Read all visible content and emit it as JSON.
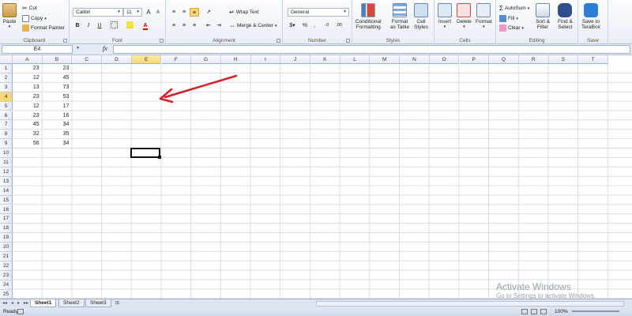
{
  "ribbon": {
    "clipboard": {
      "paste": "Paste",
      "cut": "Cut",
      "copy": "Copy",
      "format_painter": "Format Painter",
      "label": "Clipboard"
    },
    "font": {
      "name": "Calibri",
      "size": "11",
      "label": "Font",
      "bold": "B",
      "italic": "I",
      "underline": "U",
      "grow": "A",
      "shrink": "A"
    },
    "alignment": {
      "wrap_text": "Wrap Text",
      "merge_center": "Merge & Center",
      "label": "Alignment"
    },
    "number": {
      "format": "General",
      "label": "Number",
      "percent": "%",
      "comma": ",",
      "inc_dec": ".0",
      "dec_dec": ".00"
    },
    "styles": {
      "conditional": "Conditional",
      "conditional2": "Formatting",
      "format_table": "Format",
      "format_table2": "as Table",
      "cell_styles": "Cell",
      "cell_styles2": "Styles",
      "label": "Styles"
    },
    "cells": {
      "insert": "Insert",
      "delete": "Delete",
      "format": "Format",
      "label": "Cells"
    },
    "editing": {
      "autosum": "AutoSum",
      "fill": "Fill",
      "clear": "Clear",
      "sort_filter": "Sort &",
      "sort_filter2": "Filter",
      "find_select": "Find &",
      "find_select2": "Select",
      "label": "Editing"
    },
    "save": {
      "save_terabox": "Save to",
      "save_terabox2": "TeraBox",
      "label": "Save"
    }
  },
  "formula_bar": {
    "name_box": "E4",
    "fx": "fx",
    "value": ""
  },
  "columns": [
    "A",
    "B",
    "C",
    "D",
    "E",
    "F",
    "G",
    "H",
    "I",
    "J",
    "K",
    "L",
    "M",
    "N",
    "O",
    "P",
    "Q",
    "R",
    "S",
    "T"
  ],
  "rows": [
    "1",
    "2",
    "3",
    "4",
    "5",
    "6",
    "7",
    "8",
    "9",
    "10",
    "11",
    "12",
    "13",
    "14",
    "15",
    "16",
    "17",
    "18",
    "19",
    "20",
    "21",
    "22",
    "23",
    "24",
    "25"
  ],
  "selected_cell": {
    "column": "E",
    "row": "4"
  },
  "cells": {
    "A": [
      "23",
      "12",
      "13",
      "23",
      "12",
      "23",
      "45",
      "32",
      "56"
    ],
    "B": [
      "23",
      "45",
      "73",
      "53",
      "17",
      "16",
      "34",
      "35",
      "34"
    ]
  },
  "sheet_tabs": [
    "Sheet1",
    "Sheet2",
    "Sheet3"
  ],
  "active_sheet": "Sheet1",
  "status": {
    "ready": "Ready",
    "zoom": "100%"
  },
  "watermark": {
    "line1": "Activate Windows",
    "line2": "Go to Settings to activate Windows."
  },
  "annotation": {
    "arrow_color": "#d0202a"
  }
}
